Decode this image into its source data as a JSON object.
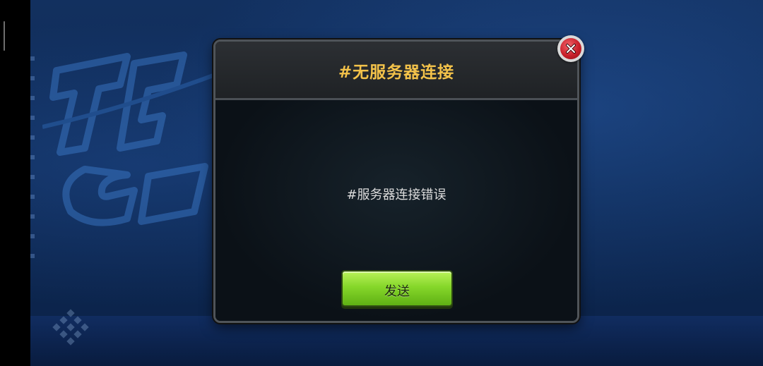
{
  "dialog": {
    "title": "#无服务器连接",
    "message": "#服务器连接错误",
    "send_label": "发送"
  },
  "icons": {
    "close": "close-x-icon",
    "background_logo": "game-logo-watermark",
    "background_deco": "diamond-pattern-icon"
  },
  "colors": {
    "title": "#f3c24a",
    "button": "#86d72a",
    "close": "#c8202a",
    "background": "#0e2a55"
  }
}
